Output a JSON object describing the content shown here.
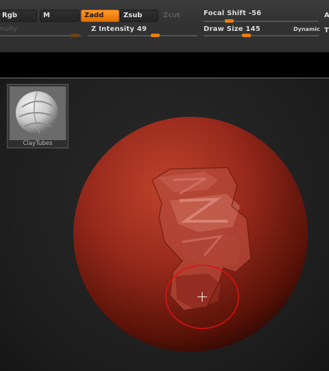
{
  "toolbar": {
    "rgb_label": "Rgb",
    "m_label": "M",
    "zadd_label": "Zadd",
    "zsub_label": "Zsub",
    "zcut_label": "Zcut",
    "rgb_intensity_label": "nsity",
    "z_intensity_label": "Z Intensity 49",
    "focal_shift_label": "Focal Shift -56",
    "draw_size_label": "Draw Size 145",
    "dynamic_label": "Dynamic",
    "edge_label_a": "A",
    "edge_label_t": "T"
  },
  "sliders": {
    "rgb_intensity": 0.92,
    "z_intensity": 0.49,
    "focal_shift": 0.22,
    "draw_size": 0.37
  },
  "brush": {
    "name": "ClayTubes"
  },
  "colors": {
    "accent": "#e8800e",
    "sculpt": "#9b2a1c",
    "cursor_ring": "#e01010"
  }
}
